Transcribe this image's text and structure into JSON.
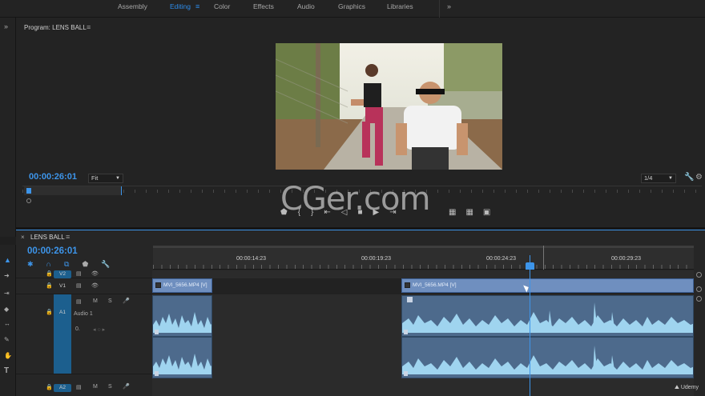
{
  "workspaces": {
    "tabs": [
      {
        "label": "Assembly",
        "active": false
      },
      {
        "label": "Editing",
        "active": true
      },
      {
        "label": "Color",
        "active": false
      },
      {
        "label": "Effects",
        "active": false
      },
      {
        "label": "Audio",
        "active": false
      },
      {
        "label": "Graphics",
        "active": false
      },
      {
        "label": "Libraries",
        "active": false
      }
    ],
    "active_menu_icon": "≡",
    "more_icon": "»"
  },
  "program_monitor": {
    "title": "Program: LENS BALL",
    "menu_icon": "≡",
    "timecode": "00:00:26:01",
    "fit": "Fit",
    "resolution": "1/4",
    "watermark": "CGer.com"
  },
  "timeline": {
    "close_icon": "×",
    "sequence_name": "LENS BALL",
    "menu_icon": "≡",
    "timecode": "00:00:26:01",
    "ruler_labels": [
      "00:00:14:23",
      "00:00:19:23",
      "00:00:24:23",
      "00:00:29:23"
    ],
    "tracks": {
      "v2": "V2",
      "v1": "V1",
      "a1": "A1",
      "a2": "A2",
      "audio1_name": "Audio 1",
      "mute": "M",
      "solo": "S",
      "volume": "0."
    },
    "clips": {
      "v1_clip_1": "MVI_5656.MP4 [V]",
      "v1_clip_2": "MVI_5656.MP4 [V]"
    }
  },
  "branding": {
    "udemy": "Udemy"
  },
  "colors": {
    "accent_blue": "#3d95ea",
    "video_clip": "#6f8fbf",
    "audio_clip": "#4d6a8c",
    "waveform": "#9fd4ef"
  }
}
